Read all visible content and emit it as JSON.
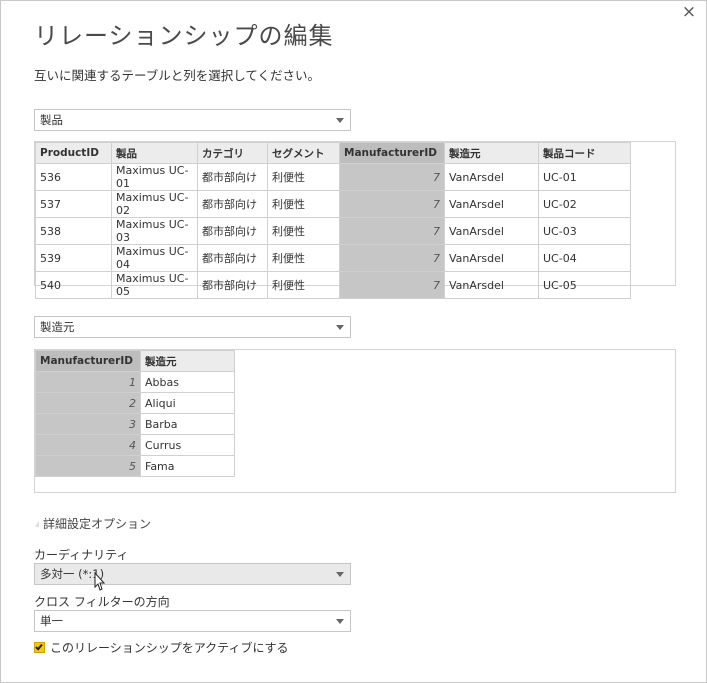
{
  "dialog": {
    "title": "リレーションシップの編集",
    "subtitle": "互いに関連するテーブルと列を選択してください。",
    "close_label": "×"
  },
  "table1": {
    "select_value": "製品",
    "columns": [
      "ProductID",
      "製品",
      "カテゴリ",
      "セグメント",
      "ManufacturerID",
      "製造元",
      "製品コード"
    ],
    "selected_column": "ManufacturerID",
    "rows": [
      [
        "536",
        "Maximus UC-01",
        "都市部向け",
        "利便性",
        "7",
        "VanArsdel",
        "UC-01"
      ],
      [
        "537",
        "Maximus UC-02",
        "都市部向け",
        "利便性",
        "7",
        "VanArsdel",
        "UC-02"
      ],
      [
        "538",
        "Maximus UC-03",
        "都市部向け",
        "利便性",
        "7",
        "VanArsdel",
        "UC-03"
      ],
      [
        "539",
        "Maximus UC-04",
        "都市部向け",
        "利便性",
        "7",
        "VanArsdel",
        "UC-04"
      ],
      [
        "540",
        "Maximus UC-05",
        "都市部向け",
        "利便性",
        "7",
        "VanArsdel",
        "UC-05"
      ]
    ]
  },
  "table2": {
    "select_value": "製造元",
    "columns": [
      "ManufacturerID",
      "製造元"
    ],
    "selected_column": "ManufacturerID",
    "rows": [
      [
        "1",
        "Abbas"
      ],
      [
        "2",
        "Aliqui"
      ],
      [
        "3",
        "Barba"
      ],
      [
        "4",
        "Currus"
      ],
      [
        "5",
        "Fama"
      ]
    ]
  },
  "advanced": {
    "toggle_label": "詳細設定オプション",
    "cardinality_label": "カーディナリティ",
    "cardinality_value": "多対一 (*:1)",
    "crossfilter_label": "クロス フィルターの方向",
    "crossfilter_value": "単一",
    "active_label": "このリレーションシップをアクティブにする",
    "active_checked": true
  }
}
